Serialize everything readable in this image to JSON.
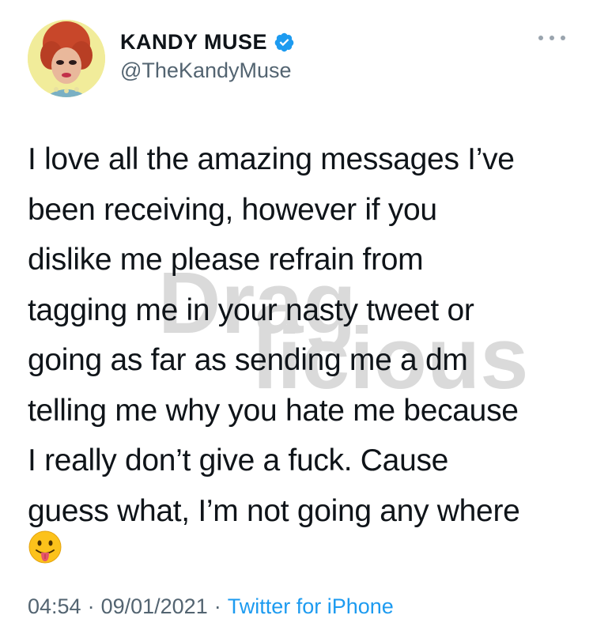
{
  "author": {
    "display_name": "KANDY MUSE",
    "handle": "@TheKandyMuse",
    "verified": true,
    "avatar_icon": "avatar"
  },
  "tweet": {
    "lines": [
      "I love all the amazing messages I’ve",
      "been receiving, however if you",
      "dislike me please refrain from",
      "tagging me in your nasty tweet or",
      "going as far as sending me a dm",
      "telling me why you hate me because",
      "I really don’t give a fuck. Cause",
      "guess what, I’m not going any where"
    ],
    "emoji": "face-with-tongue-emoji"
  },
  "watermark": {
    "line1": "Drag",
    "line2": "licious"
  },
  "meta": {
    "time": "04:54",
    "separator": "·",
    "date": "09/01/2021",
    "source": "Twitter for iPhone"
  },
  "colors": {
    "text": "#0f1419",
    "secondary": "#536471",
    "accent": "#1d9bf0"
  }
}
